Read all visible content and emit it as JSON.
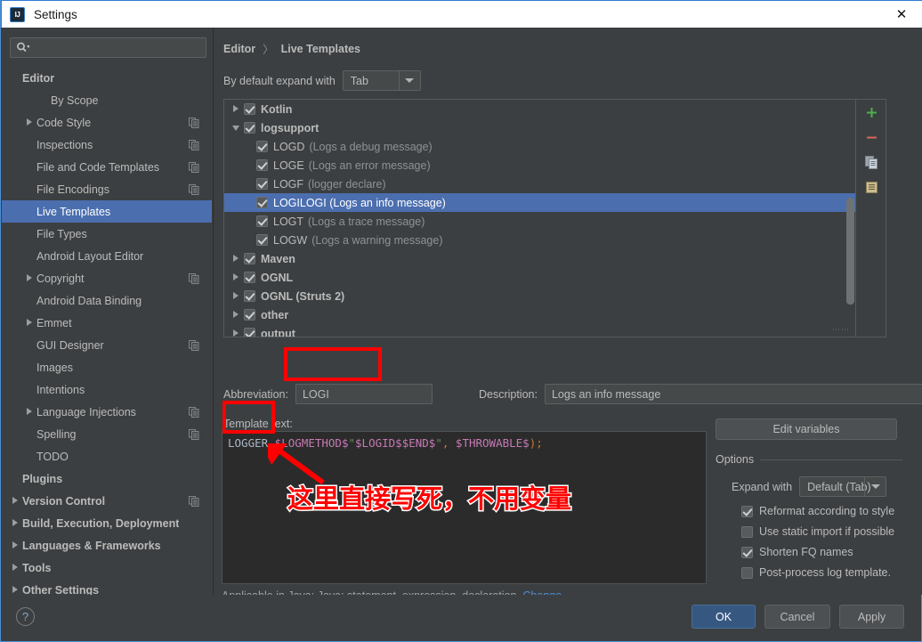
{
  "window": {
    "title": "Settings",
    "app_icon": "intellij-idea-icon",
    "close_label": "✕"
  },
  "sidebar": {
    "search": {
      "placeholder": "",
      "value": "",
      "icon": "search-icon"
    },
    "items": [
      {
        "label": "Editor",
        "indent": 0,
        "bold": true,
        "arrow": false,
        "copy": false,
        "selected": false
      },
      {
        "label": "By Scope",
        "indent": 2,
        "bold": false,
        "arrow": false,
        "copy": false,
        "selected": false
      },
      {
        "label": "Code Style",
        "indent": 1,
        "bold": false,
        "arrow": true,
        "copy": true,
        "selected": false
      },
      {
        "label": "Inspections",
        "indent": 1,
        "bold": false,
        "arrow": false,
        "copy": true,
        "selected": false
      },
      {
        "label": "File and Code Templates",
        "indent": 1,
        "bold": false,
        "arrow": false,
        "copy": true,
        "selected": false
      },
      {
        "label": "File Encodings",
        "indent": 1,
        "bold": false,
        "arrow": false,
        "copy": true,
        "selected": false
      },
      {
        "label": "Live Templates",
        "indent": 1,
        "bold": false,
        "arrow": false,
        "copy": false,
        "selected": true
      },
      {
        "label": "File Types",
        "indent": 1,
        "bold": false,
        "arrow": false,
        "copy": false,
        "selected": false
      },
      {
        "label": "Android Layout Editor",
        "indent": 1,
        "bold": false,
        "arrow": false,
        "copy": false,
        "selected": false
      },
      {
        "label": "Copyright",
        "indent": 1,
        "bold": false,
        "arrow": true,
        "copy": true,
        "selected": false
      },
      {
        "label": "Android Data Binding",
        "indent": 1,
        "bold": false,
        "arrow": false,
        "copy": false,
        "selected": false
      },
      {
        "label": "Emmet",
        "indent": 1,
        "bold": false,
        "arrow": true,
        "copy": false,
        "selected": false
      },
      {
        "label": "GUI Designer",
        "indent": 1,
        "bold": false,
        "arrow": false,
        "copy": true,
        "selected": false
      },
      {
        "label": "Images",
        "indent": 1,
        "bold": false,
        "arrow": false,
        "copy": false,
        "selected": false
      },
      {
        "label": "Intentions",
        "indent": 1,
        "bold": false,
        "arrow": false,
        "copy": false,
        "selected": false
      },
      {
        "label": "Language Injections",
        "indent": 1,
        "bold": false,
        "arrow": true,
        "copy": true,
        "selected": false
      },
      {
        "label": "Spelling",
        "indent": 1,
        "bold": false,
        "arrow": false,
        "copy": true,
        "selected": false
      },
      {
        "label": "TODO",
        "indent": 1,
        "bold": false,
        "arrow": false,
        "copy": false,
        "selected": false
      },
      {
        "label": "Plugins",
        "indent": 0,
        "bold": true,
        "arrow": false,
        "copy": false,
        "selected": false
      },
      {
        "label": "Version Control",
        "indent": 0,
        "bold": true,
        "arrow": true,
        "copy": true,
        "selected": false
      },
      {
        "label": "Build, Execution, Deployment",
        "indent": 0,
        "bold": true,
        "arrow": true,
        "copy": false,
        "selected": false
      },
      {
        "label": "Languages & Frameworks",
        "indent": 0,
        "bold": true,
        "arrow": true,
        "copy": false,
        "selected": false
      },
      {
        "label": "Tools",
        "indent": 0,
        "bold": true,
        "arrow": true,
        "copy": false,
        "selected": false
      },
      {
        "label": "Other Settings",
        "indent": 0,
        "bold": true,
        "arrow": true,
        "copy": false,
        "selected": false
      }
    ]
  },
  "content": {
    "breadcrumb": {
      "parent": "Editor",
      "separator": "〉",
      "current": "Live Templates"
    },
    "expand_default": {
      "label": "By default expand with",
      "value": "Tab"
    },
    "tree": {
      "rows": [
        {
          "label": "Kotlin",
          "desc": "",
          "level": 0,
          "arrow": "closed",
          "checked": true,
          "selected": false
        },
        {
          "label": "logsupport",
          "desc": "",
          "level": 0,
          "arrow": "open",
          "checked": true,
          "selected": false
        },
        {
          "label": "LOGD",
          "desc": "(Logs a debug message)",
          "level": 1,
          "arrow": "none",
          "checked": true,
          "selected": false
        },
        {
          "label": "LOGE",
          "desc": "(Logs an error message)",
          "level": 1,
          "arrow": "none",
          "checked": true,
          "selected": false
        },
        {
          "label": "LOGF",
          "desc": "(logger declare)",
          "level": 1,
          "arrow": "none",
          "checked": true,
          "selected": false
        },
        {
          "label": "LOGI",
          "desc": "(Logs an info message)",
          "level": 1,
          "arrow": "none",
          "checked": true,
          "selected": true
        },
        {
          "label": "LOGT",
          "desc": "(Logs a trace message)",
          "level": 1,
          "arrow": "none",
          "checked": true,
          "selected": false
        },
        {
          "label": "LOGW",
          "desc": "(Logs a warning message)",
          "level": 1,
          "arrow": "none",
          "checked": true,
          "selected": false
        },
        {
          "label": "Maven",
          "desc": "",
          "level": 0,
          "arrow": "closed",
          "checked": true,
          "selected": false
        },
        {
          "label": "OGNL",
          "desc": "",
          "level": 0,
          "arrow": "closed",
          "checked": true,
          "selected": false
        },
        {
          "label": "OGNL (Struts 2)",
          "desc": "",
          "level": 0,
          "arrow": "closed",
          "checked": true,
          "selected": false
        },
        {
          "label": "other",
          "desc": "",
          "level": 0,
          "arrow": "closed",
          "checked": true,
          "selected": false
        },
        {
          "label": "output",
          "desc": "",
          "level": 0,
          "arrow": "closed",
          "checked": true,
          "selected": false
        }
      ],
      "toolbar": [
        {
          "icon": "add-icon",
          "glyph": "+",
          "color": "#4caf50"
        },
        {
          "icon": "remove-icon",
          "glyph": "−",
          "color": "#d9655a"
        },
        {
          "icon": "duplicate-icon",
          "glyph": "",
          "color": "#a0aab4"
        },
        {
          "icon": "template-group-icon",
          "glyph": "",
          "color": "#b9a97a"
        }
      ]
    },
    "abbreviation": {
      "label": "Abbreviation:",
      "value": "LOGI"
    },
    "description": {
      "label": "Description:",
      "value": "Logs an info message"
    },
    "template_text": {
      "label": "Template text:",
      "tokens": [
        {
          "t": "LOGGER",
          "c": "c-def"
        },
        {
          "t": ".",
          "c": "c-def"
        },
        {
          "t": "$LOGMETHOD$",
          "c": "c-var"
        },
        {
          "t": "\"",
          "c": "c-str"
        },
        {
          "t": "$LOGID$$END$",
          "c": "c-var"
        },
        {
          "t": "\"",
          "c": "c-str"
        },
        {
          "t": ",",
          "c": "c-punc"
        },
        {
          "t": " ",
          "c": "c-def"
        },
        {
          "t": "$THROWABLE$",
          "c": "c-var"
        },
        {
          "t": ")",
          "c": "c-punc"
        },
        {
          "t": ";",
          "c": "c-punc"
        }
      ]
    },
    "applicable": {
      "text": "Applicable in Java; Java: statement, expression, declaration.",
      "change_link": "Change"
    },
    "edit_variables_button": "Edit variables",
    "options": {
      "title": "Options",
      "expand_with": {
        "label": "Expand with",
        "value": "Default (Tab)"
      },
      "checkboxes": [
        {
          "label": "Reformat according to style",
          "checked": true
        },
        {
          "label": "Use static import if possible",
          "checked": false
        },
        {
          "label": "Shorten FQ names",
          "checked": true
        },
        {
          "label": "Post-process log template.",
          "checked": false
        }
      ]
    }
  },
  "footer": {
    "help": "?",
    "ok": "OK",
    "cancel": "Cancel",
    "apply": "Apply"
  },
  "annotations": {
    "note_text": "这里直接写死，不用变量",
    "highlight_color": "#ff0000"
  }
}
